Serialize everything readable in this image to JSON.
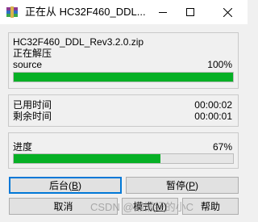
{
  "window": {
    "title": "正在从 HC32F460_DDL...",
    "minimize_label": "—",
    "maximize_label": "□",
    "close_label": "✕"
  },
  "status": {
    "archive_name": "HC32F460_DDL_Rev3.2.0.zip",
    "action": "正在解压",
    "current_item": "source",
    "current_percent_text": "100%",
    "current_progress": 1.0
  },
  "time": {
    "elapsed_label": "已用时间",
    "elapsed_value": "00:00:02",
    "remaining_label": "剩余时间",
    "remaining_value": "00:00:01"
  },
  "overall": {
    "label": "进度",
    "percent_text": "67%",
    "progress": 0.67
  },
  "buttons": {
    "background": {
      "label": "后台",
      "mnemonic": "B"
    },
    "pause": {
      "label": "暂停",
      "mnemonic": "P"
    },
    "cancel": {
      "label": "取消"
    },
    "mode": {
      "label": "模式",
      "mnemonic": "M"
    },
    "help": {
      "label": "帮助"
    }
  },
  "watermark": "CSDN @懒懒经的小C",
  "colors": {
    "progress_fill": "#06b025",
    "focus_border": "#0078d7"
  }
}
